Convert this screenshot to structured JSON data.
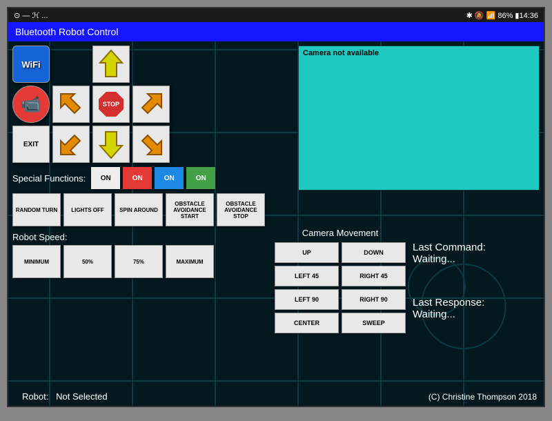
{
  "status": {
    "left": "⊙ — ℋ ...",
    "right": "✱ 🔕 📶 86% ▮14:36"
  },
  "title": "Bluetooth Robot Control",
  "buttons": {
    "wifi": "WiFi",
    "exit": "EXIT",
    "stop": "STOP"
  },
  "camera": {
    "not_available": "Camera not available"
  },
  "special": {
    "label": "Special Functions:",
    "on": "ON"
  },
  "functions": [
    "RANDOM TURN",
    "LIGHTS OFF",
    "SPIN AROUND",
    "OBSTACLE AVOIDANCE START",
    "OBSTACLE AVOIDANCE STOP"
  ],
  "speed": {
    "label": "Robot Speed:",
    "opts": [
      "MINIMUM",
      "50%",
      "75%",
      "MAXIMUM"
    ]
  },
  "camMove": {
    "title": "Camera Movement",
    "btns": [
      "UP",
      "DOWN",
      "LEFT 45",
      "RIGHT 45",
      "LEFT 90",
      "RIGHT 90",
      "CENTER",
      "SWEEP"
    ]
  },
  "lastCmd": {
    "label": "Last Command:",
    "val": "Waiting..."
  },
  "lastResp": {
    "label": "Last Response:",
    "val": "Waiting..."
  },
  "robot": {
    "label": "Robot:",
    "val": "Not Selected"
  },
  "copyright": "(C) Christine Thompson 2018"
}
